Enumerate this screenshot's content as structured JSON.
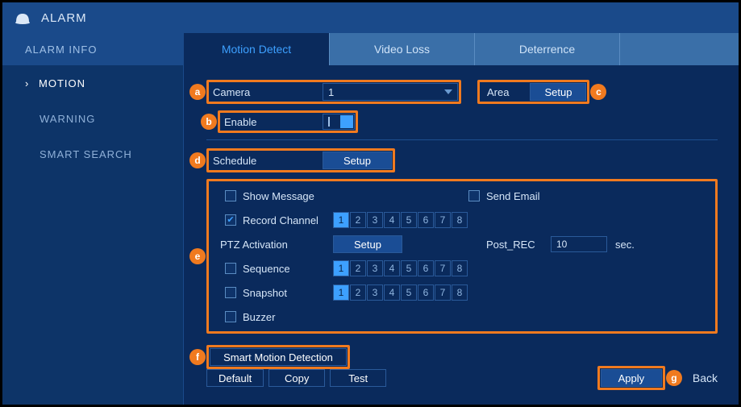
{
  "title": "ALARM",
  "sidebar": {
    "top": "ALARM INFO",
    "items": [
      {
        "label": "MOTION",
        "active": true
      },
      {
        "label": "WARNING"
      },
      {
        "label": "SMART SEARCH"
      }
    ]
  },
  "tabs": [
    {
      "label": "Motion Detect",
      "active": true
    },
    {
      "label": "Video Loss"
    },
    {
      "label": "Deterrence"
    }
  ],
  "form": {
    "camera_label": "Camera",
    "camera_value": "1",
    "area_label": "Area",
    "area_btn": "Setup",
    "enable_label": "Enable",
    "schedule_label": "Schedule",
    "schedule_btn": "Setup",
    "show_message_label": "Show Message",
    "send_email_label": "Send Email",
    "record_channel_label": "Record Channel",
    "ptz_label": "PTZ Activation",
    "ptz_btn": "Setup",
    "postrec_label": "Post_REC",
    "postrec_value": "10",
    "postrec_unit": "sec.",
    "sequence_label": "Sequence",
    "snapshot_label": "Snapshot",
    "buzzer_label": "Buzzer",
    "channels": [
      "1",
      "2",
      "3",
      "4",
      "5",
      "6",
      "7",
      "8"
    ],
    "smart_btn": "Smart Motion Detection"
  },
  "footer": {
    "default": "Default",
    "copy": "Copy",
    "test": "Test",
    "apply": "Apply",
    "back": "Back"
  },
  "callouts": {
    "a": "a",
    "b": "b",
    "c": "c",
    "d": "d",
    "e": "e",
    "f": "f",
    "g": "g"
  }
}
